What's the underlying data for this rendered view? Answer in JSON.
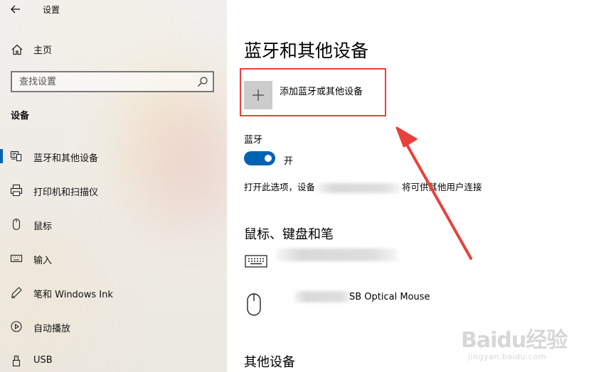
{
  "window": {
    "title": "设置"
  },
  "sidebar": {
    "home_label": "主页",
    "search_placeholder": "查找设置",
    "section_title": "设备",
    "items": [
      {
        "label": "蓝牙和其他设备",
        "icon": "bluetooth-devices-icon",
        "selected": true
      },
      {
        "label": "打印机和扫描仪",
        "icon": "printer-icon",
        "selected": false
      },
      {
        "label": "鼠标",
        "icon": "mouse-icon",
        "selected": false
      },
      {
        "label": "输入",
        "icon": "keyboard-input-icon",
        "selected": false
      },
      {
        "label": "笔和 Windows Ink",
        "icon": "pen-icon",
        "selected": false
      },
      {
        "label": "自动播放",
        "icon": "autoplay-icon",
        "selected": false
      },
      {
        "label": "USB",
        "icon": "usb-icon",
        "selected": false
      }
    ]
  },
  "main": {
    "title": "蓝牙和其他设备",
    "add_device_label": "添加蓝牙或其他设备",
    "bluetooth": {
      "label": "蓝牙",
      "state": "开",
      "on": true,
      "discover_prefix": "打开此选项，设备",
      "discover_suffix": "将可供其他用户连接"
    },
    "mouse_keyboard_pen": {
      "header": "鼠标、键盘和笔",
      "devices": [
        {
          "icon": "keyboard-icon",
          "name": ""
        },
        {
          "icon": "mouse-device-icon",
          "name": "SB Optical Mouse"
        }
      ]
    },
    "other_devices_header": "其他设备"
  },
  "colors": {
    "accent": "#0063b1",
    "annotation": "#e8413c"
  },
  "watermark": {
    "logo": "Baidu经验",
    "url": "jingyan.baidu.com"
  }
}
